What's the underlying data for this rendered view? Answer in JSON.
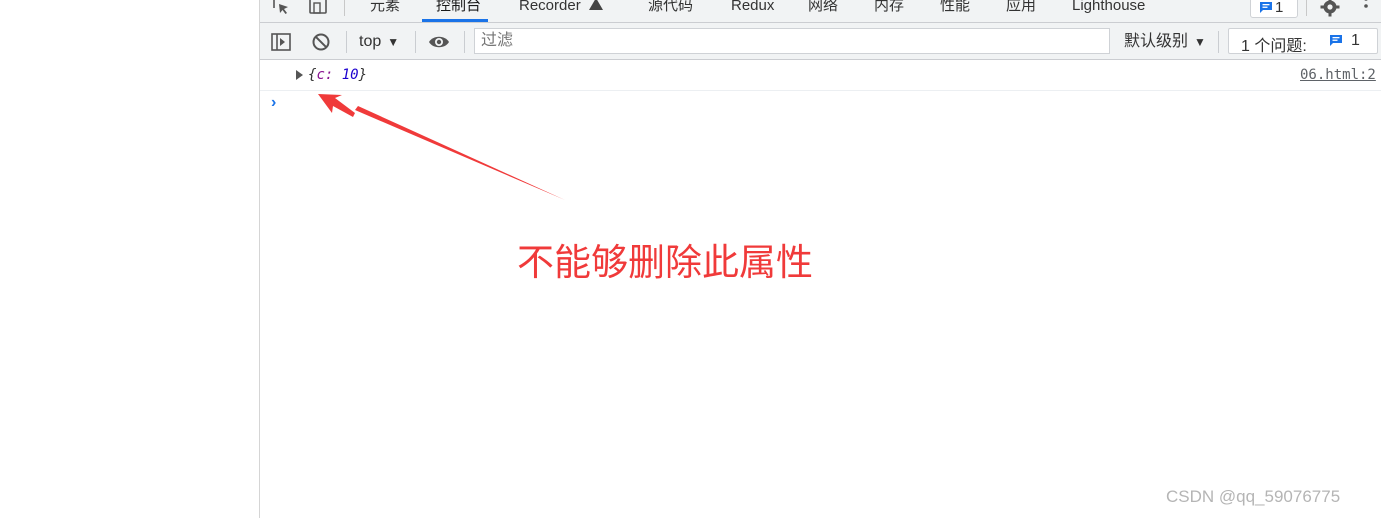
{
  "tabs": [
    {
      "label": "元素"
    },
    {
      "label": "控制台"
    },
    {
      "label": "Recorder"
    },
    {
      "label": "源代码"
    },
    {
      "label": "Redux"
    },
    {
      "label": "网络"
    },
    {
      "label": "内存"
    },
    {
      "label": "性能"
    },
    {
      "label": "应用"
    },
    {
      "label": "Lighthouse"
    }
  ],
  "tabbar": {
    "message_count": "1"
  },
  "toolbar": {
    "context": "top",
    "filter_placeholder": "过滤",
    "level": "默认级别",
    "issues_label": "1 个问题:",
    "issues_count": "1"
  },
  "console": {
    "open_brace": "{",
    "key": "c:",
    "value": "10",
    "close_brace": "}",
    "source": "06.html:2"
  },
  "annotation": {
    "text": "不能够删除此属性"
  },
  "watermark": {
    "text": "CSDN @qq_59076775"
  },
  "colors": {
    "accent": "#1a73e8",
    "annotation": "#f03a3a"
  }
}
